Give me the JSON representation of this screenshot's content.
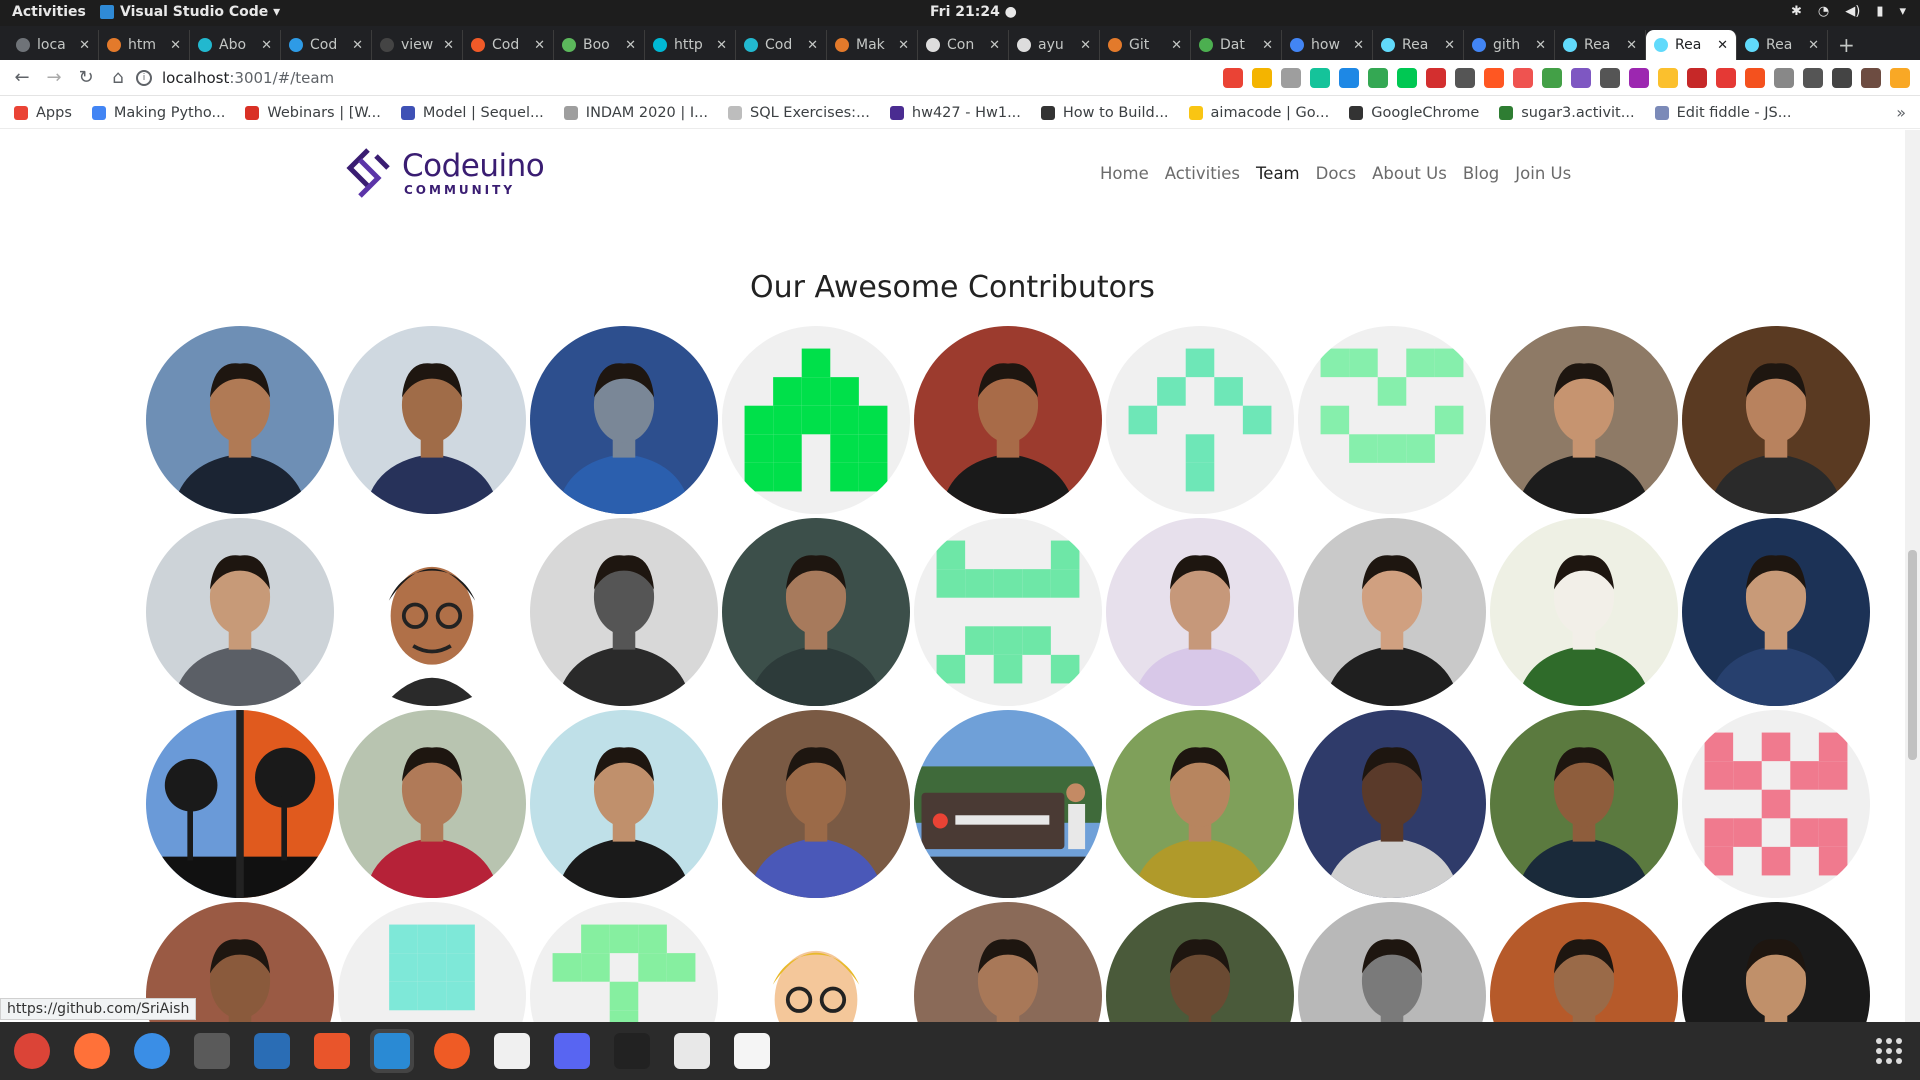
{
  "topbar": {
    "activities": "Activities",
    "app_name": "Visual Studio Code ▾",
    "clock": "Fri 21:24 ●"
  },
  "browser": {
    "tabs": [
      {
        "label": "loca",
        "color": "#6f7378"
      },
      {
        "label": "htm",
        "color": "#e37a2b"
      },
      {
        "label": "Abo",
        "color": "#22b8cf"
      },
      {
        "label": "Cod",
        "color": "#2e9be6"
      },
      {
        "label": "view",
        "color": "#444"
      },
      {
        "label": "Cod",
        "color": "#f05a28"
      },
      {
        "label": "Boo",
        "color": "#5cb85c"
      },
      {
        "label": "http",
        "color": "#00b8d4"
      },
      {
        "label": "Cod",
        "color": "#22b8cf"
      },
      {
        "label": "Mak",
        "color": "#e37a2b"
      },
      {
        "label": "Con",
        "color": "#ddd"
      },
      {
        "label": "ayu",
        "color": "#ddd"
      },
      {
        "label": "Git",
        "color": "#e37a2b"
      },
      {
        "label": "Dat",
        "color": "#4caf50"
      },
      {
        "label": "how",
        "color": "#4285f4"
      },
      {
        "label": "Rea",
        "color": "#61dafb"
      },
      {
        "label": "gith",
        "color": "#4285f4"
      },
      {
        "label": "Rea",
        "color": "#61dafb"
      },
      {
        "label": "Rea",
        "color": "#61dafb",
        "active": true
      },
      {
        "label": "Rea",
        "color": "#61dafb"
      }
    ],
    "new_tab": "+",
    "url_host": "localhost",
    "url_path": ":3001/#/team",
    "bookmarks": [
      {
        "label": "Apps",
        "color": "#ea4335"
      },
      {
        "label": "Making Pytho...",
        "color": "#4285f4"
      },
      {
        "label": "Webinars | [W...",
        "color": "#d93025"
      },
      {
        "label": "Model | Sequel...",
        "color": "#3f51b5"
      },
      {
        "label": "INDAM 2020 | I...",
        "color": "#9e9e9e"
      },
      {
        "label": "SQL Exercises:...",
        "color": "#bdbdbd"
      },
      {
        "label": "hw427 - Hw1...",
        "color": "#4a2c91"
      },
      {
        "label": "How to Build...",
        "color": "#333"
      },
      {
        "label": "aimacode | Go...",
        "color": "#f9c513"
      },
      {
        "label": "GoogleChrome",
        "color": "#333"
      },
      {
        "label": "sugar3.activit...",
        "color": "#2e7d32"
      },
      {
        "label": "Edit fiddle - JS...",
        "color": "#7b8ab8"
      }
    ],
    "bookmarks_more": "»",
    "status_url": "https://github.com/SriAish"
  },
  "site": {
    "logo_name": "Codeuino",
    "logo_sub": "COMMUNITY",
    "nav": [
      "Home",
      "Activities",
      "Team",
      "Docs",
      "About Us",
      "Blog",
      "Join Us"
    ],
    "nav_current": "Team",
    "heading": "Our Awesome Contributors"
  },
  "contributors": [
    {
      "kind": "photo",
      "bg": "#6e8fb5",
      "skin": "#b07a55",
      "shirt": "#1b2433"
    },
    {
      "kind": "photo",
      "bg": "#cfd8e0",
      "skin": "#a06c48",
      "shirt": "#27325a"
    },
    {
      "kind": "photo",
      "bg": "#2d4f8e",
      "skin": "#7a8797",
      "shirt": "#2b5fae"
    },
    {
      "kind": "identicon",
      "color": "#00e04a",
      "pattern": "pat_a"
    },
    {
      "kind": "photo",
      "bg": "#9c3b2e",
      "skin": "#a86b48",
      "shirt": "#1a1a1a"
    },
    {
      "kind": "identicon",
      "color": "#6ee7b7",
      "pattern": "pat_b"
    },
    {
      "kind": "identicon",
      "color": "#86efac",
      "pattern": "pat_c"
    },
    {
      "kind": "photo",
      "bg": "#8e7a66",
      "skin": "#c69470",
      "shirt": "#1c1c1c"
    },
    {
      "kind": "photo",
      "bg": "#5a3a22",
      "skin": "#b8825e",
      "shirt": "#2a2a2a"
    },
    {
      "kind": "photo",
      "bg": "#cdd3d8",
      "skin": "#c79a78",
      "shirt": "#5b5f66"
    },
    {
      "kind": "cartoon",
      "bg": "#ffffff",
      "skin": "#b07048",
      "shirt": "#2a2a2a"
    },
    {
      "kind": "photo",
      "bg": "#d8d8d8",
      "skin": "#555555",
      "shirt": "#2a2a2a"
    },
    {
      "kind": "photo",
      "bg": "#3c4f4a",
      "skin": "#a77a5c",
      "shirt": "#2d3b3a"
    },
    {
      "kind": "identicon",
      "color": "#6ee7a7",
      "pattern": "pat_d"
    },
    {
      "kind": "photo",
      "bg": "#e7e0ec",
      "skin": "#c6987a",
      "shirt": "#d8c8e8"
    },
    {
      "kind": "photo",
      "bg": "#c9c9c9",
      "skin": "#d0a080",
      "shirt": "#1f1f1f"
    },
    {
      "kind": "photo",
      "bg": "#eef0e4",
      "skin": "#f2efe8",
      "shirt": "#2f6b2a"
    },
    {
      "kind": "photo",
      "bg": "#1c3256",
      "skin": "#c89a78",
      "shirt": "#27406e"
    },
    {
      "kind": "scene",
      "bg": "#e05a1e",
      "skin": "#1a1a1a",
      "shirt": "#224a90"
    },
    {
      "kind": "photo",
      "bg": "#b8c4b0",
      "skin": "#b07a58",
      "shirt": "#b62238"
    },
    {
      "kind": "photo",
      "bg": "#bfe0e8",
      "skin": "#c0906c",
      "shirt": "#1a1a1a"
    },
    {
      "kind": "photo",
      "bg": "#7a5a44",
      "skin": "#9b6a48",
      "shirt": "#4a58b8"
    },
    {
      "kind": "google",
      "bg": "#6fa0d8",
      "skin": "#3f6a3a",
      "shirt": "#4a3a34"
    },
    {
      "kind": "photo",
      "bg": "#7fa05a",
      "skin": "#b7855f",
      "shirt": "#b09a2a"
    },
    {
      "kind": "photo",
      "bg": "#2f3b6a",
      "skin": "#5a3a2a",
      "shirt": "#d0d0d0"
    },
    {
      "kind": "photo",
      "bg": "#5b7a3f",
      "skin": "#8e5d3c",
      "shirt": "#1a2a3a"
    },
    {
      "kind": "identicon",
      "color": "#f07a8e",
      "pattern": "pat_e"
    },
    {
      "kind": "photo",
      "bg": "#9a5a44",
      "skin": "#8a5a3c",
      "shirt": "#3b2a6e"
    },
    {
      "kind": "identicon",
      "color": "#7ee8d8",
      "pattern": "pat_f"
    },
    {
      "kind": "identicon",
      "color": "#86efa0",
      "pattern": "pat_g"
    },
    {
      "kind": "cartoon2",
      "bg": "#ffffff",
      "skin": "#f4c79a",
      "shirt": "#2a4aa8"
    },
    {
      "kind": "photo",
      "bg": "#8a6a58",
      "skin": "#a87858",
      "shirt": "#c23a2a"
    },
    {
      "kind": "photo",
      "bg": "#4a5a3a",
      "skin": "#6a4a32",
      "shirt": "#e83a6a"
    },
    {
      "kind": "photo",
      "bg": "#b8b8b8",
      "skin": "#7a7a7a",
      "shirt": "#2a2a2a"
    },
    {
      "kind": "photo",
      "bg": "#b65a2a",
      "skin": "#9a6a48",
      "shirt": "#3a5a9a"
    },
    {
      "kind": "photo",
      "bg": "#1a1a1a",
      "skin": "#c0906a",
      "shirt": "#d2232a"
    }
  ],
  "dock": [
    {
      "name": "chrome",
      "color": "#db4437"
    },
    {
      "name": "firefox",
      "color": "#ff7139"
    },
    {
      "name": "thunderbird",
      "color": "#3a8ee6"
    },
    {
      "name": "files",
      "color": "#5a5a5a"
    },
    {
      "name": "writer",
      "color": "#2a6db5"
    },
    {
      "name": "software",
      "color": "#e9552b"
    },
    {
      "name": "vscode",
      "color": "#2a8ad4",
      "active": true
    },
    {
      "name": "postman",
      "color": "#ef5b25"
    },
    {
      "name": "amazon",
      "color": "#f0f0f0"
    },
    {
      "name": "discord",
      "color": "#5865f2"
    },
    {
      "name": "inkscape",
      "color": "#222"
    },
    {
      "name": "text-editor",
      "color": "#e8e8e8"
    },
    {
      "name": "document",
      "color": "#f5f5f5"
    }
  ]
}
